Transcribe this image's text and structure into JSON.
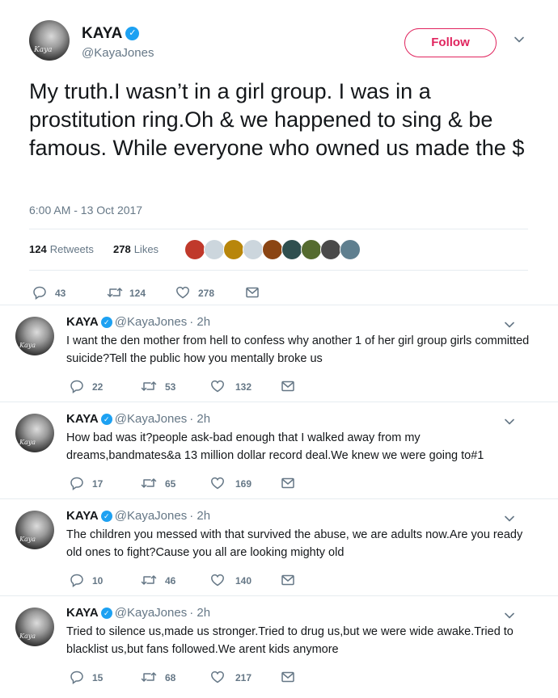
{
  "main_tweet": {
    "name": "KAYA",
    "handle": "@KayaJones",
    "avatar_tag": "Kaya",
    "follow_label": "Follow",
    "text": "My truth.I wasn’t in a girl group. I was in a prostitution ring.Oh & we happened to sing & be famous. While everyone who owned us made the $",
    "timestamp": "6:00 AM - 13 Oct 2017",
    "retweets_count": "124",
    "retweets_label": "Retweets",
    "likes_count": "278",
    "likes_label": "Likes",
    "likers": [
      {
        "color": "#c0392b"
      },
      {
        "color": "#ccd6dd"
      },
      {
        "color": "#b8860b"
      },
      {
        "color": "#ccd6dd"
      },
      {
        "color": "#8b4513"
      },
      {
        "color": "#2f4f4f"
      },
      {
        "color": "#556b2f"
      },
      {
        "color": "#4a4a4a"
      },
      {
        "color": "#5f7f8f"
      }
    ],
    "actions": {
      "replies": "43",
      "retweets": "124",
      "likes": "278"
    }
  },
  "replies": [
    {
      "name": "KAYA",
      "handle": "@KayaJones",
      "time": "· 2h",
      "text": "I want the den mother from hell to confess why another 1 of her girl group girls committed suicide?Tell the public how you mentally broke us",
      "replies": "22",
      "retweets": "53",
      "likes": "132"
    },
    {
      "name": "KAYA",
      "handle": "@KayaJones",
      "time": "· 2h",
      "text": "How bad was it?people ask-bad enough that I walked away from my dreams,bandmates&a 13 million dollar record deal.We knew we were going to#1",
      "replies": "17",
      "retweets": "65",
      "likes": "169"
    },
    {
      "name": "KAYA",
      "handle": "@KayaJones",
      "time": "· 2h",
      "text": "The children you messed with that survived the abuse, we are adults now.Are you ready old ones to fight?Cause you all are looking mighty old",
      "replies": "10",
      "retweets": "46",
      "likes": "140"
    },
    {
      "name": "KAYA",
      "handle": "@KayaJones",
      "time": "· 2h",
      "text": "Tried to silence us,made us stronger.Tried to drug us,but we were wide awake.Tried to blacklist us,but fans followed.We arent kids anymore",
      "replies": "15",
      "retweets": "68",
      "likes": "217"
    }
  ],
  "icons": {
    "verified": "verified-badge-icon",
    "reply": "reply-icon",
    "retweet": "retweet-icon",
    "like": "heart-icon",
    "dm": "envelope-icon",
    "caret": "chevron-down-icon"
  },
  "colors": {
    "follow": "#e0245e",
    "verified": "#1da1f2",
    "muted": "#657786",
    "divider": "#e6ecf0"
  }
}
